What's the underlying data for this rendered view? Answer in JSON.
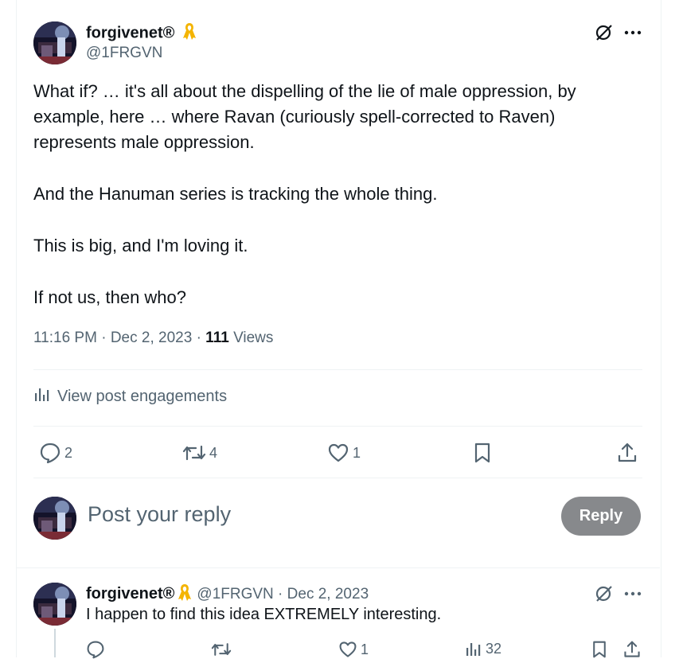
{
  "post": {
    "author_name": "forgivenet®",
    "author_handle": "@1FRGVN",
    "paragraphs": [
      "What if? … it's all about the dispelling of the lie of male oppression, by example, here … where Ravan (curiously spell-corrected to Raven) represents male oppression.",
      "And the Hanuman series is tracking the whole thing.",
      "This is big, and I'm loving it.",
      "If not us, then who?"
    ],
    "time": "11:16 PM",
    "date": "Dec 2, 2023",
    "views_count": "111",
    "views_label": "Views",
    "engagements_label": "View post engagements",
    "actions": {
      "replies": "2",
      "reposts": "4",
      "likes": "1"
    }
  },
  "composer": {
    "placeholder": "Post your reply",
    "reply_label": "Reply"
  },
  "reply": {
    "author_name": "forgivenet®",
    "author_handle": "@1FRGVN",
    "date": "Dec 2, 2023",
    "text": "I happen to find this idea EXTREMELY interesting.",
    "likes": "1",
    "views": "32"
  },
  "colors": {
    "text": "#0f1419",
    "secondary": "#536471",
    "divider": "#eff3f4",
    "ribbon": "#f4b400",
    "reply_button": "#87898c"
  },
  "icons": [
    "grok-icon",
    "more-icon",
    "ribbon-icon",
    "reply-icon",
    "repost-icon",
    "like-icon",
    "bookmark-icon",
    "share-icon",
    "analytics-icon"
  ]
}
